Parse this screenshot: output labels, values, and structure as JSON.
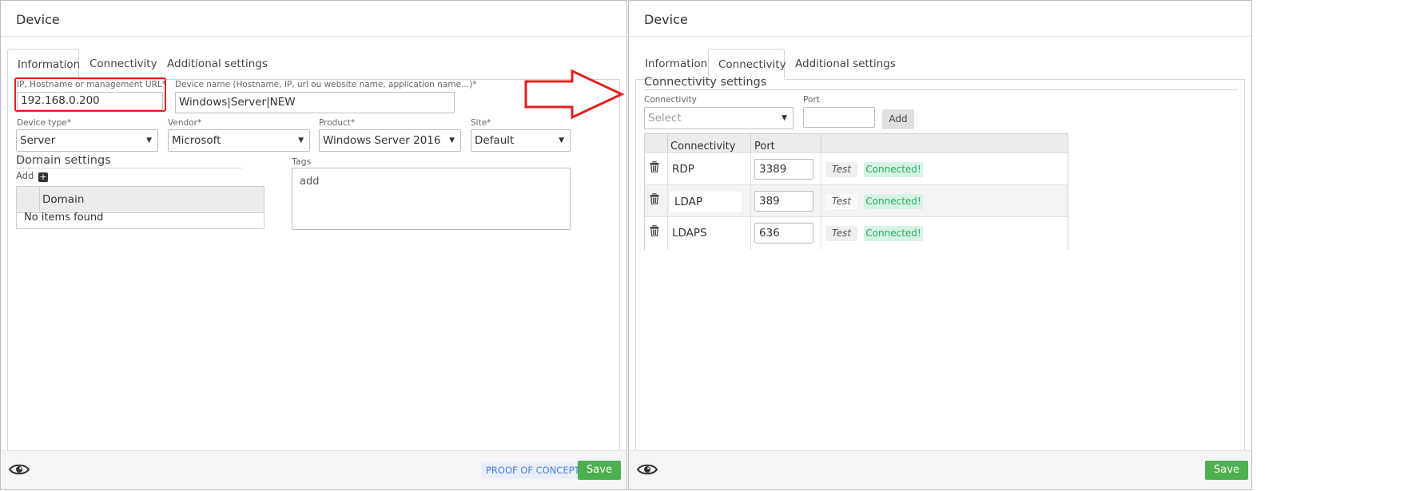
{
  "left_panel": {
    "title": "Device",
    "tabs": [
      "Information",
      "Connectivity",
      "Additional settings"
    ],
    "active_tab": "Information",
    "ip_label": "IP, Hostname or management URL*",
    "ip_value": "192.168.0.200",
    "device_name_label": "Device name (Hostname, IP, url ou website name, application name...)*",
    "device_name_value": "Windows|Server|NEW",
    "device_type_label": "Device type*",
    "device_type_value": "Server",
    "vendor_label": "Vendor*",
    "vendor_value": "Microsoft",
    "product_label": "Product*",
    "product_value": "Windows Server 2016",
    "site_label": "Site*",
    "site_value": "Default",
    "domain_settings_title": "Domain settings",
    "add_label": "Add",
    "domain_table_header": "Domain",
    "no_items": "No items found",
    "tags_label": "Tags",
    "tags_placeholder": "add",
    "proof_of_concept": "PROOF OF CONCEPT",
    "save_label": "Save"
  },
  "right_panel": {
    "title": "Device",
    "tabs": [
      "Information",
      "Connectivity",
      "Additional settings"
    ],
    "active_tab": "Connectivity",
    "section_title": "Connectivity settings",
    "connectivity_label": "Connectivity",
    "connectivity_placeholder": "Select",
    "port_label": "Port",
    "add_button": "Add",
    "table_headers": [
      "Connectivity",
      "Port"
    ],
    "rows": [
      {
        "protocol": "RDP",
        "port": "3389",
        "test": "Test",
        "status": "Connected!"
      },
      {
        "protocol": "LDAP",
        "port": "389",
        "test": "Test",
        "status": "Connected!"
      },
      {
        "protocol": "LDAPS",
        "port": "636",
        "test": "Test",
        "status": "Connected!"
      }
    ],
    "save_label": "Save"
  },
  "colors": {
    "highlight_red": "#e02020",
    "save_green": "#4caf50",
    "connected_bg": "#d7f3e6",
    "connected_text": "#27ae60",
    "poc_text": "#4a7fd6"
  }
}
